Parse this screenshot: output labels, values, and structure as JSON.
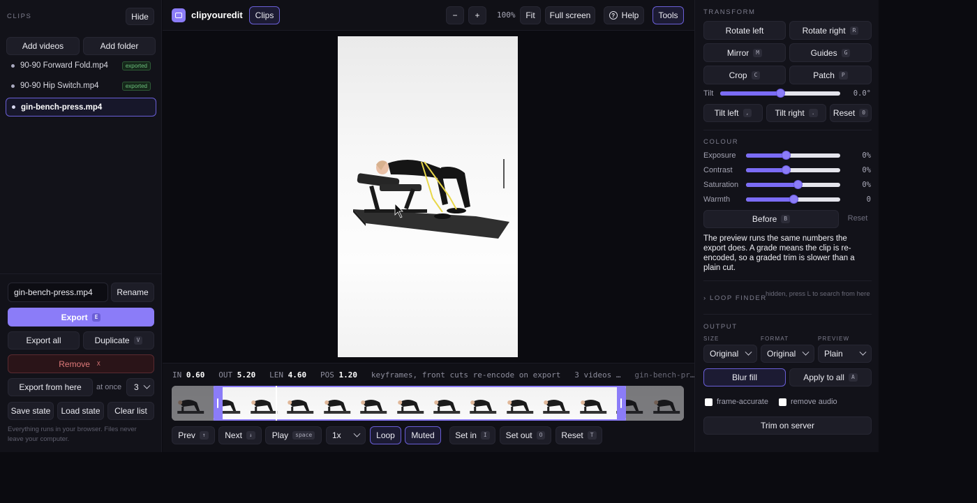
{
  "sidebar": {
    "title": "CLIPS",
    "hide_label": "Hide",
    "add_videos_label": "Add videos",
    "add_folder_label": "Add folder",
    "clips": [
      {
        "name": "90-90 Forward Fold.mp4",
        "badge": "exported"
      },
      {
        "name": "90-90 Hip Switch.mp4",
        "badge": "exported"
      },
      {
        "name": "gin-bench-press.mp4",
        "badge": ""
      }
    ],
    "rename_value": "gin-bench-press.mp4",
    "rename_label": "Rename",
    "export_label": "Export",
    "export_key": "E",
    "export_all_label": "Export all",
    "duplicate_label": "Duplicate",
    "duplicate_key": "V",
    "remove_label": "Remove",
    "remove_key": "X",
    "export_from_here_label": "Export from here",
    "at_once_label": "at once",
    "at_once_value": "3",
    "save_state_label": "Save state",
    "load_state_label": "Load state",
    "clear_list_label": "Clear list",
    "footer_note": "Everything runs in your browser. Files never leave your computer."
  },
  "topbar": {
    "app_name": "clipyouredit",
    "clips_tab": "Clips",
    "zoom_out": "−",
    "zoom_in": "+",
    "zoom_level": "100%",
    "fit_label": "Fit",
    "fullscreen_label": "Full screen",
    "help_label": "Help",
    "tools_label": "Tools"
  },
  "timeline": {
    "in_label": "IN",
    "in_value": "0.60",
    "out_label": "OUT",
    "out_value": "5.20",
    "len_label": "LEN",
    "len_value": "4.60",
    "pos_label": "POS",
    "pos_value": "1.20",
    "note": "keyframes, front cuts re-encode on export",
    "videos_count": "3 videos …",
    "current_file": "gin-bench-pr…",
    "frame_count": 14,
    "trim_start": 0.082,
    "trim_end": 0.887,
    "playhead": 0.203
  },
  "controls": {
    "prev_label": "Prev",
    "prev_key": "↑",
    "next_label": "Next",
    "next_key": "↓",
    "play_label": "Play",
    "play_key": "space",
    "speed_value": "1x",
    "loop_label": "Loop",
    "muted_label": "Muted",
    "set_in_label": "Set in",
    "set_in_key": "I",
    "set_out_label": "Set out",
    "set_out_key": "O",
    "reset_label": "Reset",
    "reset_key": "T"
  },
  "transform": {
    "title": "TRANSFORM",
    "rotate_left": "Rotate left",
    "rotate_right": "Rotate right",
    "rotate_right_key": "R",
    "mirror": "Mirror",
    "mirror_key": "M",
    "guides": "Guides",
    "guides_key": "G",
    "crop": "Crop",
    "crop_key": "C",
    "patch": "Patch",
    "patch_key": "P",
    "tilt_label": "Tilt",
    "tilt_value": "0.0°",
    "tilt_level": 0.5,
    "tilt_left": "Tilt left",
    "tilt_left_key": ",",
    "tilt_right": "Tilt right",
    "tilt_right_key": ".",
    "reset": "Reset",
    "reset_key": "0"
  },
  "colour": {
    "title": "COLOUR",
    "sliders": [
      {
        "label": "Exposure",
        "value": "0%",
        "level": 0.42
      },
      {
        "label": "Contrast",
        "value": "0%",
        "level": 0.42
      },
      {
        "label": "Saturation",
        "value": "0%",
        "level": 0.55
      },
      {
        "label": "Warmth",
        "value": "0",
        "level": 0.5
      }
    ],
    "before_label": "Before",
    "before_key": "B",
    "reset_label": "Reset",
    "note": "The preview runs the same numbers the export does. A grade means the clip is re-encoded, so a graded trim is slower than a plain cut."
  },
  "loop_finder": {
    "title": "› LOOP FINDER",
    "hint": "hidden, press L to search from here"
  },
  "output": {
    "title": "OUTPUT",
    "size_label": "SIZE",
    "size_value": "Original",
    "format_label": "FORMAT",
    "format_value": "Original",
    "preview_label": "PREVIEW",
    "preview_value": "Plain",
    "blur_fill": "Blur fill",
    "apply_to_all": "Apply to all",
    "apply_key": "A",
    "frame_accurate": "frame-accurate",
    "remove_audio": "remove audio",
    "trim_on_server": "Trim on server"
  },
  "colors": {
    "accent": "#8b7cf8",
    "remove_text": "#e07a7a",
    "badge_green": "#6cc27d"
  }
}
